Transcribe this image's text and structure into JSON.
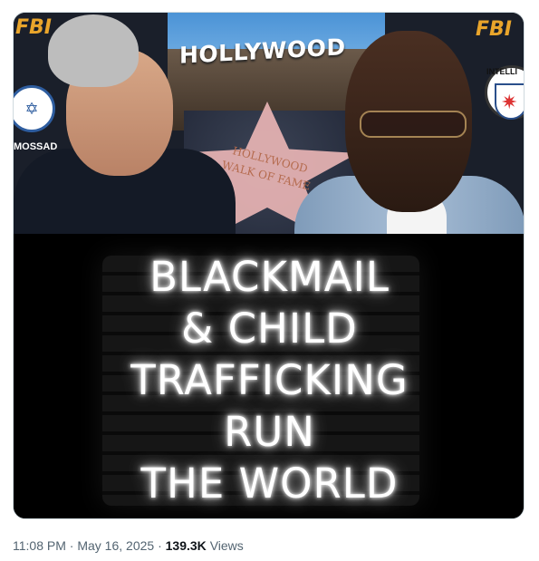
{
  "media": {
    "collage": {
      "fbi_badge_left": "FBI",
      "fbi_badge_right": "FBI",
      "hollywood_sign": "HOLLYWOOD",
      "walk_of_fame_star": "HOLLYWOOD WALK OF FAME",
      "mossad_label": "MOSSAD",
      "cia_label": "INTELLI"
    },
    "neon_sign": {
      "lines": [
        "BLACKMAIL",
        "& CHILD",
        "TRAFFICKING",
        "RUN",
        "THE WORLD"
      ]
    }
  },
  "meta": {
    "time": "11:08 PM",
    "separator": "·",
    "date": "May 16, 2025",
    "views_count": "139.3K",
    "views_label": "Views"
  }
}
